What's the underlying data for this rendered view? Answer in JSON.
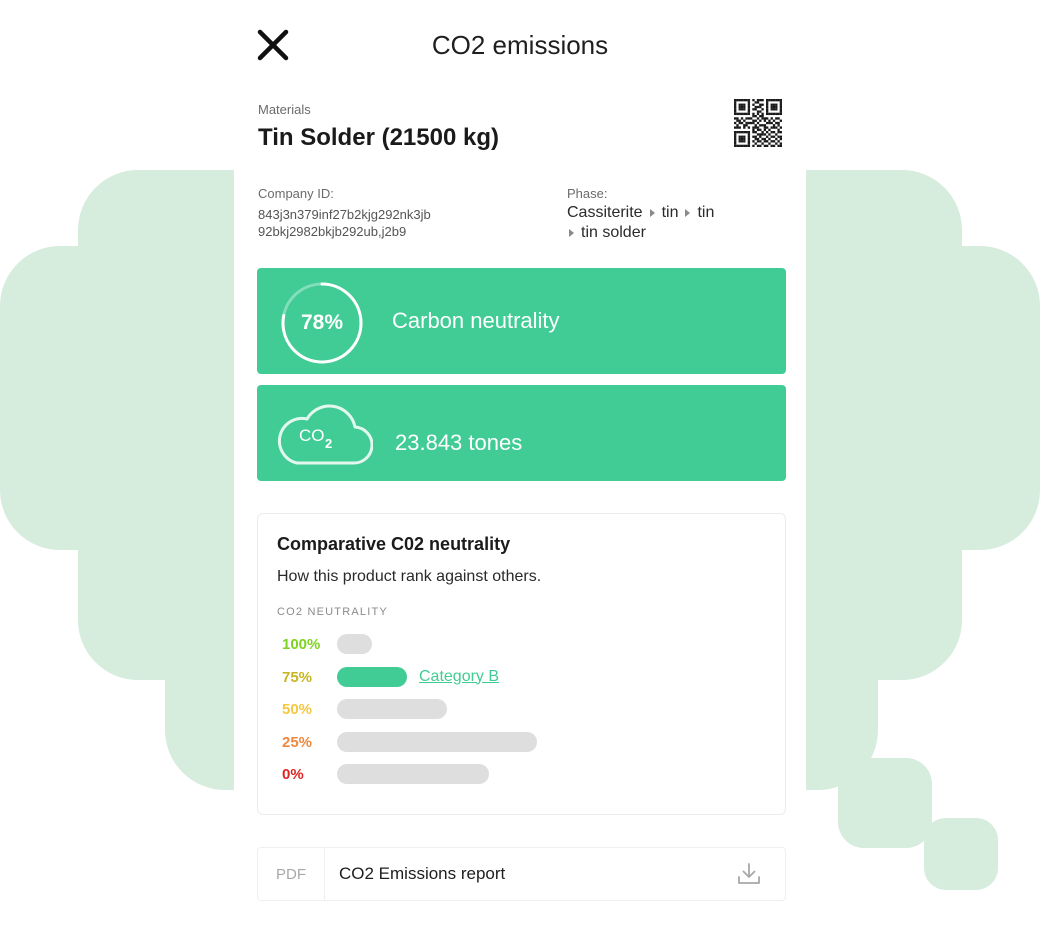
{
  "header": {
    "title": "CO2 emissions"
  },
  "material": {
    "section_label": "Materials",
    "name": "Tin Solder (21500 kg)"
  },
  "company": {
    "label": "Company ID:",
    "id_line1": "843j3n379inf27b2kjg292nk3jb",
    "id_line2": "92bkj2982bkjb292ub,j2b9"
  },
  "phase": {
    "label": "Phase:",
    "steps_line1": [
      "Cassiterite",
      "tin",
      "tin"
    ],
    "steps_line2": [
      "tin solder"
    ]
  },
  "neutrality_card": {
    "percent": "78%",
    "fraction": 0.78,
    "label": "Carbon neutrality"
  },
  "co2_card": {
    "icon_text": "CO",
    "icon_sub": "2",
    "label": "23.843 tones"
  },
  "comparison": {
    "title": "Comparative C02 neutrality",
    "subtitle": "How this product rank against others.",
    "axis_label": "CO2 NEUTRALITY",
    "rows": [
      {
        "label": "100%",
        "color": "#7ed321",
        "bar_color": "#dedede",
        "relative_length": 0.16,
        "link": ""
      },
      {
        "label": "75%",
        "color": "#c8b520",
        "bar_color": "#41cc95",
        "relative_length": 0.32,
        "link": "Category B"
      },
      {
        "label": "50%",
        "color": "#f5c842",
        "bar_color": "#dedede",
        "relative_length": 0.5,
        "link": ""
      },
      {
        "label": "25%",
        "color": "#f0883e",
        "bar_color": "#dedede",
        "relative_length": 0.91,
        "link": ""
      },
      {
        "label": "0%",
        "color": "#e02424",
        "bar_color": "#dedede",
        "relative_length": 0.69,
        "link": ""
      }
    ]
  },
  "report": {
    "tag": "PDF",
    "label": "CO2 Emissions report"
  },
  "icons": {
    "close": "close-icon",
    "qr": "qr-code-icon",
    "download": "download-icon",
    "cloud": "cloud-co2-icon"
  },
  "colors": {
    "accent": "#41cc95",
    "background_blob": "#d6ecdd"
  }
}
